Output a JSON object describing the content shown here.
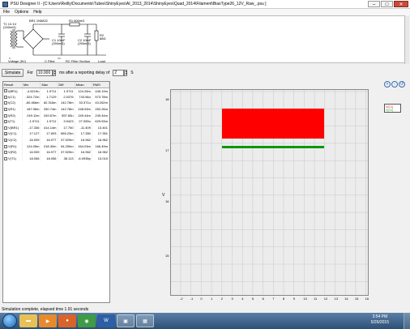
{
  "window": {
    "title": "PSU Designer II - [C:\\Users\\Reilly\\Documents\\Tubes\\ShinyEyes\\AI_2013_2014\\ShinyEyes\\Quad_2014\\Filament\\BiasType26_12V_Raw_.psu ]",
    "min": "–",
    "max": "□",
    "close": "✕"
  },
  "menu": [
    "File",
    "Options",
    "Help"
  ],
  "schematic": {
    "t1": "T1 13.1V",
    "t1_res": "(240mΩ)",
    "br1": "BR1 1N5822",
    "r1": "R1 600mΩ",
    "c1": "C1 10mF",
    "c1_esr": "(250mΩ)",
    "c2": "C2 10mF",
    "c2_esr": "(250mΩ)",
    "r2": "R2",
    "r2_val": "88Ω",
    "bottom_labels": [
      "Voltage (5V)",
      "C Filter",
      "RC Filter Section",
      "Load"
    ]
  },
  "sim": {
    "button": "Simulate",
    "for_label": "For",
    "duration": "10.000",
    "ms_text": "ms  after a reporting delay of",
    "delay": "2",
    "s_text": "S"
  },
  "results": {
    "columns": [
      "Result",
      "Min",
      "Max",
      "Diff",
      "Mean",
      "RMS"
    ],
    "rows": [
      {
        "name": "I(BR1)",
        "checked": false,
        "min": "-4.6219u",
        "max": "1.9711",
        "diff": "1.9711",
        "mean": "124.26m",
        "rms": "445.19m"
      },
      {
        "name": "I(C1)",
        "checked": false,
        "min": "-324.72m",
        "max": "1.7129",
        "diff": "2.0376",
        "mean": "743.56u",
        "rms": "573.78m"
      },
      {
        "name": "I(C2)",
        "checked": false,
        "min": "-60.466m",
        "max": "82.316m",
        "diff": "142.78m",
        "mean": "33.371u",
        "rms": "43.262m"
      },
      {
        "name": "I(R1)",
        "checked": false,
        "min": "187.96m",
        "max": "330.74m",
        "diff": "142.78m",
        "mean": "248.53m",
        "rms": "252.26m"
      },
      {
        "name": "I(R2)",
        "checked": false,
        "min": "249.11m",
        "max": "249.67m",
        "diff": "557.65u",
        "mean": "249.44m",
        "rms": "249.44m"
      },
      {
        "name": "I(T1)",
        "checked": false,
        "min": "-1.9711",
        "max": "1.9711",
        "diff": "3.9423",
        "mean": "27.059u",
        "rms": "629.53m"
      },
      {
        "name": "V(BR1)",
        "checked": false,
        "min": "-17.336",
        "max": "414.14m",
        "diff": "17.750",
        "mean": "-11.409",
        "rms": "13.401"
      },
      {
        "name": "V(C1)",
        "checked": true,
        "min": "17.127",
        "max": "17.693",
        "diff": "565.23m",
        "mean": "17.350",
        "rms": "17.351"
      },
      {
        "name": "V(C2)",
        "checked": true,
        "min": "16.939",
        "max": "16.977",
        "diff": "37.929m",
        "mean": "16.962",
        "rms": "16.962"
      },
      {
        "name": "V(R1)",
        "checked": false,
        "min": "124.05m",
        "max": "218.30m",
        "diff": "94.250m",
        "mean": "164.03m",
        "rms": "166.49m"
      },
      {
        "name": "V(R2)",
        "checked": false,
        "min": "16.939",
        "max": "16.977",
        "diff": "37.929m",
        "mean": "16.962",
        "rms": "16.962"
      },
      {
        "name": "V(T1)",
        "checked": false,
        "min": "18.056",
        "max": "18.056",
        "diff": "36.113",
        "mean": "-6.0935p",
        "rms": "13.015"
      }
    ]
  },
  "graph": {
    "y_ticks": [
      "18",
      "17",
      "16",
      "15"
    ],
    "x_ticks": [
      "-2",
      "-1",
      "0",
      "1",
      "2",
      "3",
      "4",
      "5",
      "6",
      "7",
      "8",
      "9",
      "10",
      "11",
      "12",
      "13",
      "14",
      "15",
      "16"
    ],
    "ylabel": "V",
    "legend": [
      "V(C1)",
      "V(C2)"
    ],
    "zoom_buttons": [
      "+",
      "-",
      "↺"
    ],
    "colors": {
      "vc1": "#ff0000",
      "vc2": "#009900",
      "grid": "#c8c8c8"
    }
  },
  "status": "Simulation complete, elapsed time 1.91 seconds",
  "taskbar": {
    "icons": [
      "explorer-folder",
      "media-player",
      "firefox",
      "chrome",
      "word",
      "app",
      "psu-designer"
    ],
    "time": "3:54 PM",
    "date": "5/26/2015"
  }
}
